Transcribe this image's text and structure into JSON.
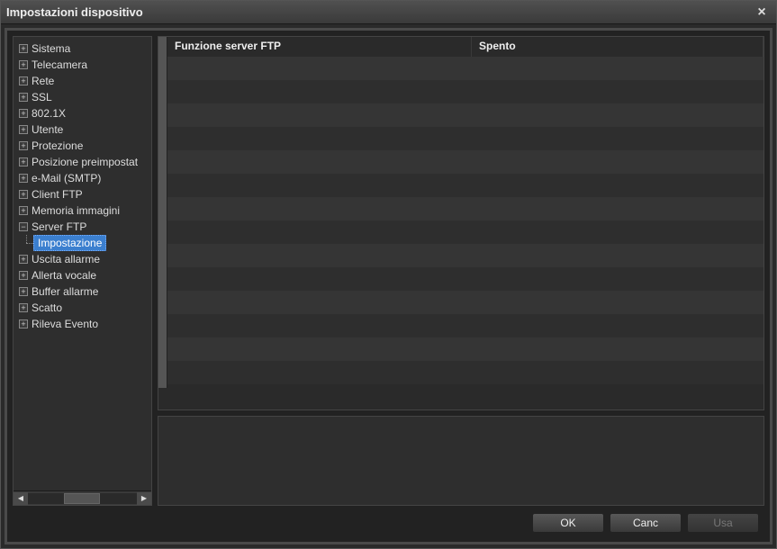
{
  "window": {
    "title": "Impostazioni dispositivo"
  },
  "sidebar": {
    "items": [
      {
        "label": "Sistema",
        "expander": "+"
      },
      {
        "label": "Telecamera",
        "expander": "+"
      },
      {
        "label": "Rete",
        "expander": "+"
      },
      {
        "label": "SSL",
        "expander": "+"
      },
      {
        "label": "802.1X",
        "expander": "+"
      },
      {
        "label": "Utente",
        "expander": "+"
      },
      {
        "label": "Protezione",
        "expander": "+"
      },
      {
        "label": "Posizione preimpostat",
        "expander": "+"
      },
      {
        "label": "e-Mail (SMTP)",
        "expander": "+"
      },
      {
        "label": "Client FTP",
        "expander": "+"
      },
      {
        "label": "Memoria immagini",
        "expander": "+"
      },
      {
        "label": "Server FTP",
        "expander": "−",
        "child": {
          "label": "Impostazione",
          "selected": true
        }
      },
      {
        "label": "Uscita allarme",
        "expander": "+"
      },
      {
        "label": "Allerta vocale",
        "expander": "+"
      },
      {
        "label": "Buffer allarme",
        "expander": "+"
      },
      {
        "label": "Scatto",
        "expander": "+"
      },
      {
        "label": "Rileva Evento",
        "expander": "+"
      }
    ]
  },
  "grid": {
    "header": {
      "key": "Funzione server FTP",
      "value": "Spento"
    }
  },
  "buttons": {
    "ok": "OK",
    "cancel": "Canc",
    "use": "Usa"
  }
}
